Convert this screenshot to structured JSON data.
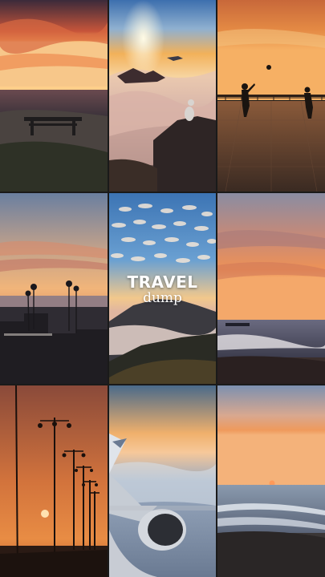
{
  "overlay": {
    "title": "TRAVEL",
    "subtitle": "dump"
  },
  "tiles": [
    {
      "name": "beach-sunset-with-bench",
      "row": 1,
      "col": 1
    },
    {
      "name": "mountain-summit-above-clouds",
      "row": 1,
      "col": 2
    },
    {
      "name": "promenade-silhouettes-at-sunset",
      "row": 1,
      "col": 3
    },
    {
      "name": "palm-coast-dusk",
      "row": 2,
      "col": 1
    },
    {
      "name": "cloud-pattern-sky-over-mountain",
      "row": 2,
      "col": 2
    },
    {
      "name": "ocean-shore-sunset",
      "row": 2,
      "col": 3
    },
    {
      "name": "street-lamps-orange-sunset",
      "row": 3,
      "col": 1
    },
    {
      "name": "airplane-wing-above-clouds",
      "row": 3,
      "col": 2
    },
    {
      "name": "calm-beach-sunset",
      "row": 3,
      "col": 3
    }
  ],
  "colors": {
    "background": "#1a1a1a",
    "sunset_orange": "#e8742c",
    "sky_blue": "#4e86c2",
    "text": "#ffffff"
  }
}
